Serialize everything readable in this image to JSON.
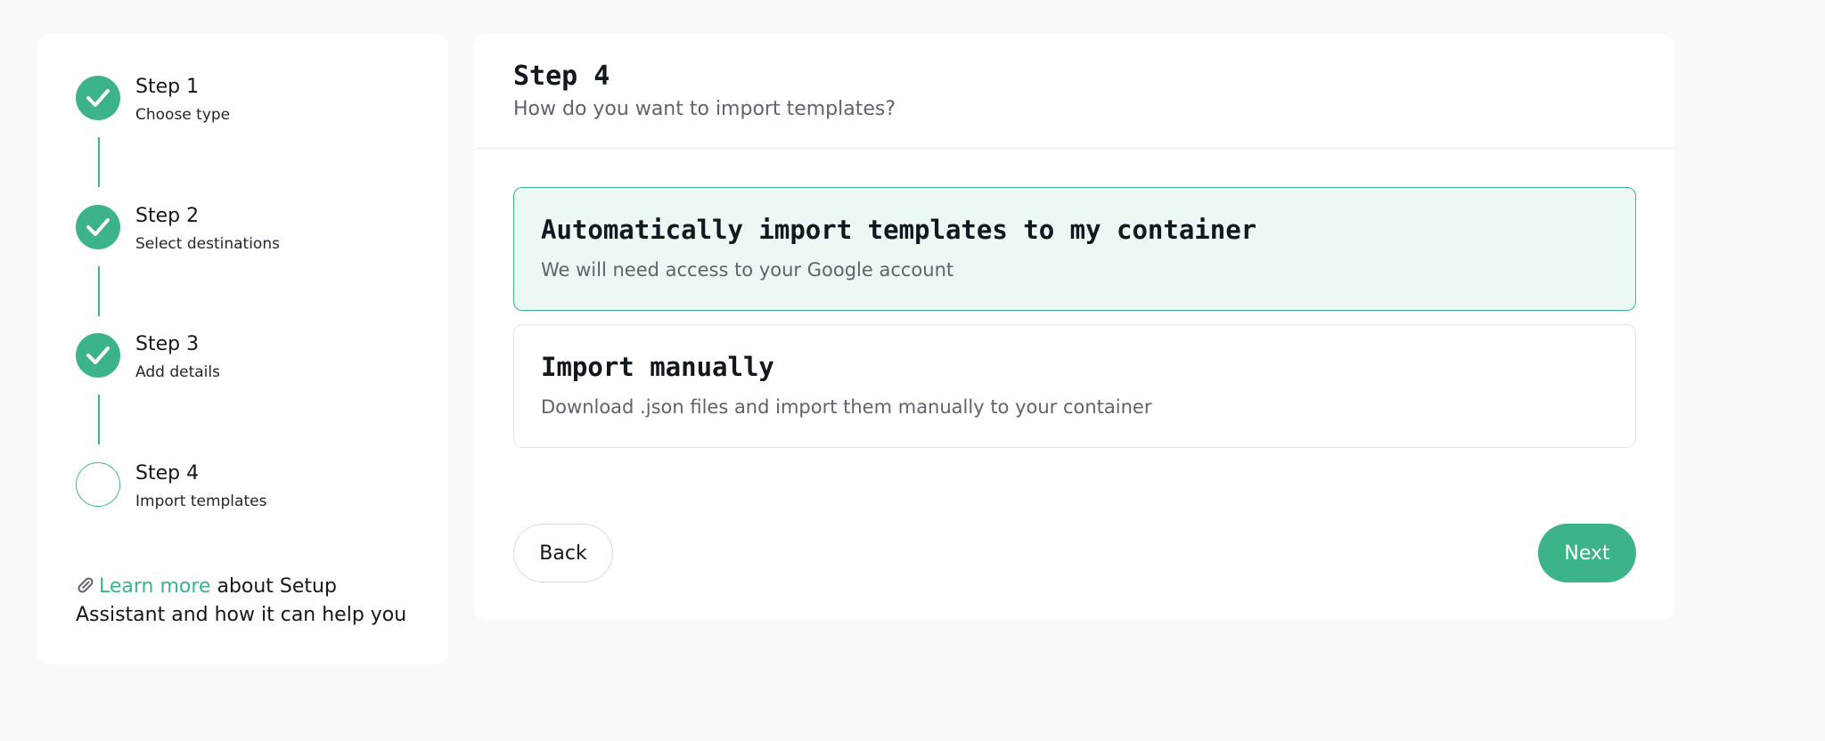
{
  "sidebar": {
    "steps": [
      {
        "title": "Step 1",
        "subtitle": "Choose type",
        "status": "done"
      },
      {
        "title": "Step 2",
        "subtitle": "Select destinations",
        "status": "done"
      },
      {
        "title": "Step 3",
        "subtitle": "Add details",
        "status": "done"
      },
      {
        "title": "Step 4",
        "subtitle": "Import templates",
        "status": "pending"
      }
    ],
    "learn_more": {
      "icon": "paperclip-icon",
      "link_text": "Learn more",
      "text": " about Setup Assistant and how it can help you"
    }
  },
  "main": {
    "title": "Step 4",
    "subtitle": "How do you want to import templates?",
    "options": [
      {
        "title": "Automatically import templates to my container",
        "description": "We will need access to your Google account",
        "selected": true
      },
      {
        "title": "Import manually",
        "description": "Download .json files and import them manually to your container",
        "selected": false
      }
    ],
    "back_label": "Back",
    "next_label": "Next"
  },
  "colors": {
    "accent": "#3db38a",
    "selected_bg": "#ecf8f3",
    "page_bg": "#f8f9fb"
  }
}
